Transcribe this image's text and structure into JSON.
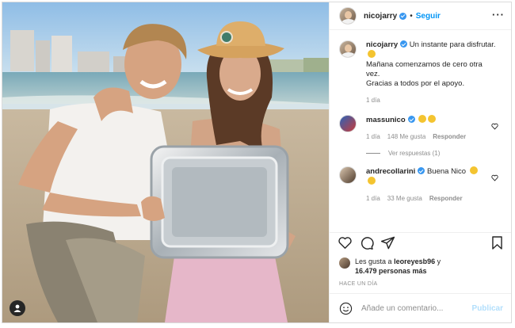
{
  "post": {
    "username": "nicojarry",
    "follow_label": "Seguir",
    "more_label": "···",
    "caption_lines": [
      "Un instante para disfrutar.",
      "Mañana comenzamos de cero otra",
      "vez.",
      "Gracias a todos por el apoyo."
    ],
    "caption_time": "1 día"
  },
  "comments": [
    {
      "username": "massunico",
      "text": "",
      "emojis": [
        "raised-hands-emoji",
        "clapping-hands-emoji"
      ],
      "time": "1 día",
      "likes": "148 Me gusta",
      "reply_label": "Responder",
      "view_replies": "Ver respuestas (1)"
    },
    {
      "username": "andrecollarini",
      "text": "Buena Nico",
      "emojis": [
        "clapping-hands-emoji",
        "clapping-hands-emoji"
      ],
      "time": "1 día",
      "likes": "33 Me gusta",
      "reply_label": "Responder"
    }
  ],
  "likes": {
    "prefix": "Les gusta a",
    "first_user": "leoreyesb96",
    "connector": "y",
    "others": "16.479 personas más"
  },
  "time_ago": "HACE UN DÍA",
  "add_comment": {
    "placeholder": "Añade un comentario...",
    "publish_label": "Publicar"
  },
  "colors": {
    "accent": "#0095f6",
    "verified": "#3897f0",
    "muted": "#8e8e8e",
    "publish_disabled": "#b2dffc"
  }
}
